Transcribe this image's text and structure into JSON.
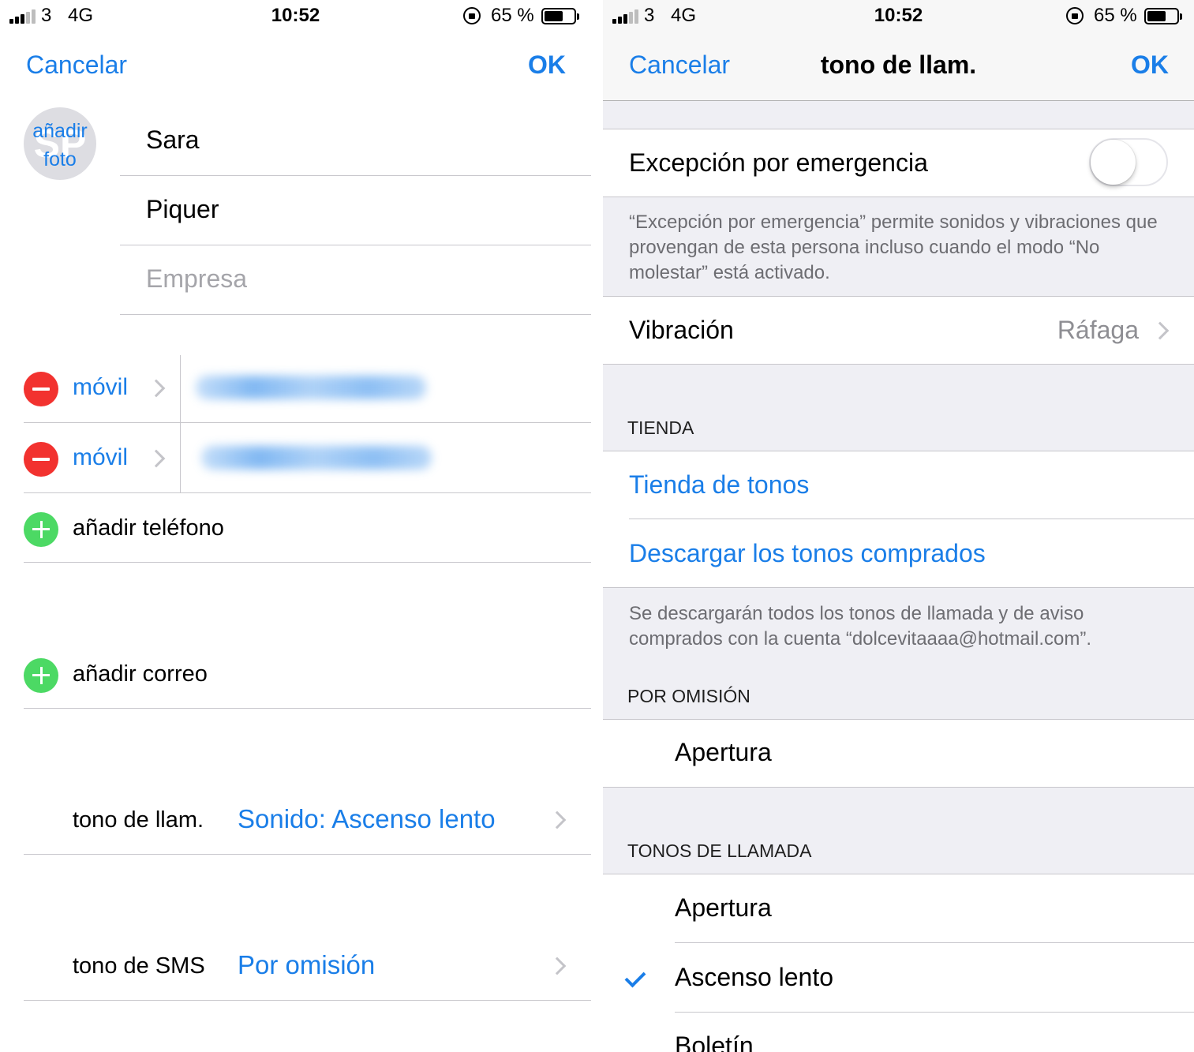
{
  "status": {
    "carrier": "3",
    "network": "4G",
    "time": "10:52",
    "battery_pct": "65 %",
    "battery_level": 0.65
  },
  "left": {
    "nav": {
      "cancel": "Cancelar",
      "ok": "OK"
    },
    "avatar": {
      "initials": "SP",
      "add_photo": "añadir foto"
    },
    "fields": {
      "first_name": "Sara",
      "last_name": "Piquer",
      "company_placeholder": "Empresa"
    },
    "phones": [
      {
        "label": "móvil"
      },
      {
        "label": "móvil"
      }
    ],
    "add_phone": "añadir teléfono",
    "add_email": "añadir correo",
    "ringtone": {
      "label": "tono de llam.",
      "value": "Sonido: Ascenso lento"
    },
    "sms": {
      "label": "tono de SMS",
      "value": "Por omisión"
    }
  },
  "right": {
    "nav": {
      "cancel": "Cancelar",
      "title": "tono de llam.",
      "ok": "OK"
    },
    "emergency": {
      "label": "Excepción por emergencia",
      "enabled": false,
      "footer": "“Excepción por emergencia” permite sonidos y vibraciones que provengan de esta persona incluso cuando el modo “No molestar” está activado."
    },
    "vibration": {
      "label": "Vibración",
      "value": "Ráfaga"
    },
    "store": {
      "header": "TIENDA",
      "tone_store": "Tienda de tonos",
      "download": "Descargar los tonos comprados",
      "footer": "Se descargarán todos los tonos de llamada y de aviso comprados con la cuenta “dolcevitaaaa@hotmail.com”."
    },
    "default_section": {
      "header": "POR OMISIÓN",
      "item": "Apertura"
    },
    "ringtones": {
      "header": "TONOS DE LLAMADA",
      "items": [
        "Apertura",
        "Ascenso lento",
        "Boletín"
      ],
      "selected": "Ascenso lento"
    }
  }
}
